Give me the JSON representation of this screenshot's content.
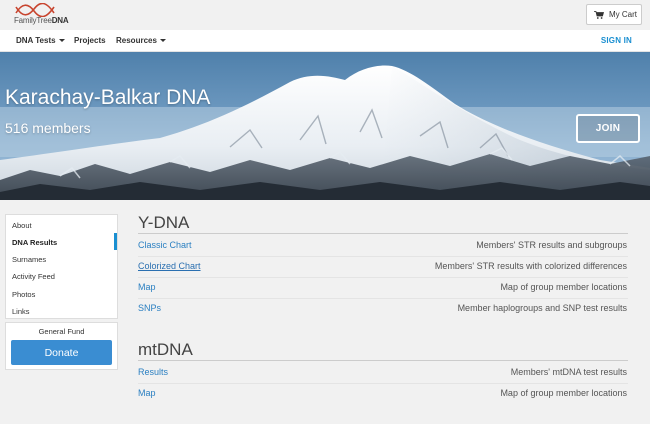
{
  "header": {
    "logo_text_a": "Family",
    "logo_text_b": "Tree",
    "logo_text_c": "DNA",
    "cart_label": "My Cart"
  },
  "nav": {
    "items": [
      {
        "label": "DNA Tests",
        "has_caret": true
      },
      {
        "label": "Projects",
        "has_caret": false
      },
      {
        "label": "Resources",
        "has_caret": true
      }
    ],
    "signin": "SIGN IN"
  },
  "hero": {
    "title": "Karachay-Balkar DNA",
    "members": "516 members",
    "join_label": "JOIN"
  },
  "sidebar": {
    "items": [
      {
        "label": "About"
      },
      {
        "label": "DNA Results",
        "active": true
      },
      {
        "label": "Surnames"
      },
      {
        "label": "Activity Feed"
      },
      {
        "label": "Photos"
      },
      {
        "label": "Links"
      }
    ],
    "fund_label": "General Fund",
    "donate_label": "Donate"
  },
  "ydna": {
    "title": "Y-DNA",
    "rows": [
      {
        "link": "Classic Chart",
        "desc": "Members' STR results and subgroups"
      },
      {
        "link": "Colorized Chart",
        "desc": "Members' STR results with colorized differences"
      },
      {
        "link": "Map",
        "desc": "Map of group member locations"
      },
      {
        "link": "SNPs",
        "desc": "Member haplogroups and SNP test results"
      }
    ]
  },
  "mtdna": {
    "title": "mtDNA",
    "rows": [
      {
        "link": "Results",
        "desc": "Members' mtDNA test results"
      },
      {
        "link": "Map",
        "desc": "Map of group member locations"
      }
    ]
  },
  "colors": {
    "accent": "#1a8fd1",
    "donate": "#3a8dd2",
    "link": "#2a7fc1"
  }
}
